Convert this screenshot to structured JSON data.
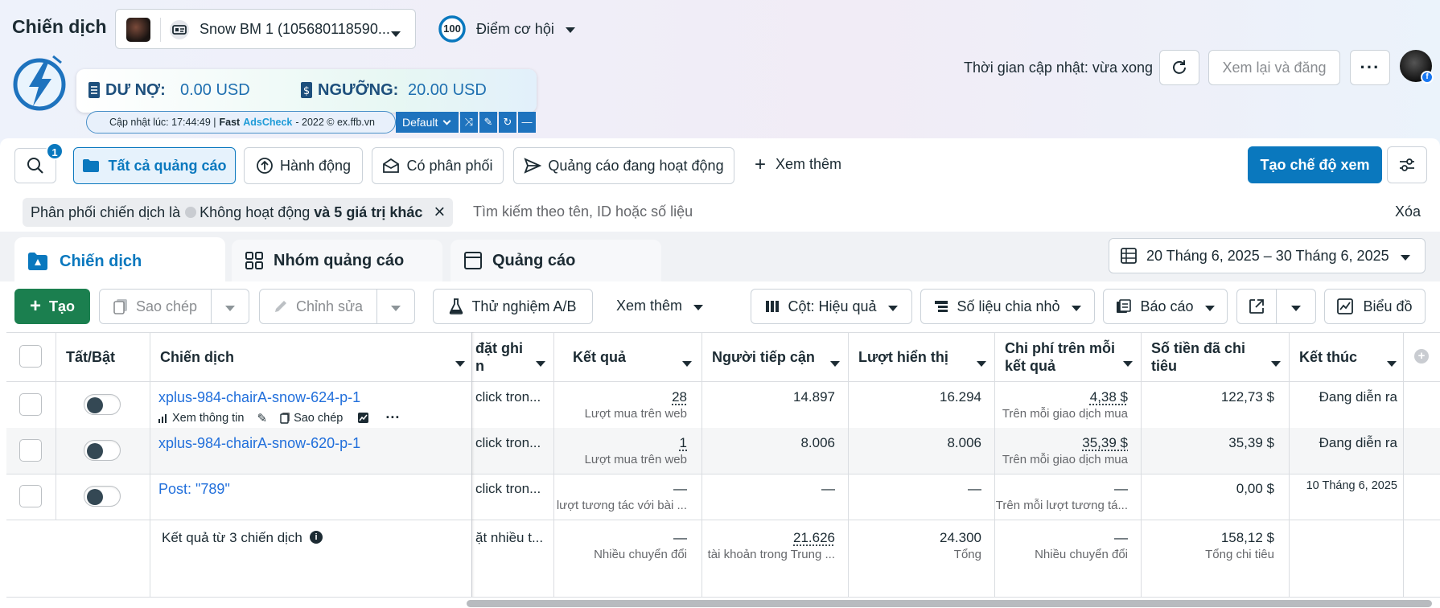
{
  "header": {
    "title": "Chiến dịch",
    "account_name": "Snow BM 1 (105680118590...",
    "opp_score_value": "100",
    "opp_score_label": "Điểm cơ hội",
    "update_time": "Thời gian cập nhật: vừa xong",
    "review_publish": "Xem lại và đăng"
  },
  "extension": {
    "debt_label": "DƯ NỢ:",
    "debt_value": "0.00 USD",
    "threshold_label": "NGƯỠNG:",
    "threshold_value": "20.00 USD",
    "updated_at": "Cập nhật lúc: 17:44:49 |",
    "brand_fast": "Fast",
    "brand_adscheck": "AdsCheck",
    "copyright": "- 2022 © ex.ffb.vn",
    "default_label": "Default"
  },
  "toolbar": {
    "search_badge": "1",
    "all_ads": "Tất cả quảng cáo",
    "actions": "Hành động",
    "delivered": "Có phân phối",
    "active_ads": "Quảng cáo đang hoạt động",
    "see_more": "Xem thêm",
    "create_view": "Tạo chế độ xem"
  },
  "filter": {
    "chip_prefix": "Phân phối chiến dịch là",
    "chip_value": "Không hoạt động",
    "chip_suffix": "và 5 giá trị khác",
    "search_placeholder": "Tìm kiếm theo tên, ID hoặc số liệu",
    "clear": "Xóa"
  },
  "tabs": {
    "campaigns": "Chiến dịch",
    "adsets": "Nhóm quảng cáo",
    "ads": "Quảng cáo",
    "date_range": "20 Tháng 6, 2025 – 30 Tháng 6, 2025"
  },
  "actions_bar": {
    "create": "Tạo",
    "duplicate": "Sao chép",
    "edit": "Chỉnh sửa",
    "ab_test": "Thử nghiệm A/B",
    "see_more": "Xem thêm",
    "columns": "Cột: Hiệu quả",
    "breakdown": "Số liệu chia nhỏ",
    "reports": "Báo cáo",
    "chart": "Biểu đồ"
  },
  "table": {
    "headers": {
      "toggle": "Tất/Bật",
      "campaign": "Chiến dịch",
      "bid_line1": "đặt ghi",
      "bid_line2": "n",
      "results": "Kết quả",
      "reach": "Người tiếp cận",
      "impressions": "Lượt hiển thị",
      "cost_line1": "Chi phí trên mỗi",
      "cost_line2": "kết quả",
      "spent_line1": "Số tiền đã chi",
      "spent_line2": "tiêu",
      "end": "Kết thúc"
    },
    "row_actions": {
      "view": "Xem thông tin",
      "duplicate": "Sao chép"
    },
    "rows": [
      {
        "name": "xplus-984-chairA-snow-624-p-1",
        "bid": "click tron...",
        "result": "28",
        "result_sub": "Lượt mua trên web",
        "reach": "14.897",
        "impressions": "16.294",
        "cost": "4,38 $",
        "cost_sub": "Trên mỗi giao dịch mua",
        "spent": "122,73 $",
        "end": "Đang diễn ra"
      },
      {
        "name": "xplus-984-chairA-snow-620-p-1",
        "bid": "click tron...",
        "result": "1",
        "result_sub": "Lượt mua trên web",
        "reach": "8.006",
        "impressions": "8.006",
        "cost": "35,39 $",
        "cost_sub": "Trên mỗi giao dịch mua",
        "spent": "35,39 $",
        "end": "Đang diễn ra"
      },
      {
        "name": "Post: \"789\"",
        "bid": "click tron...",
        "result": "—",
        "result_sub": "lượt tương tác với bài ...",
        "reach": "—",
        "impressions": "—",
        "cost": "—",
        "cost_sub": "Trên mỗi lượt tương tá...",
        "spent": "0,00 $",
        "end": "10 Tháng 6, 2025"
      }
    ],
    "summary": {
      "label": "Kết quả từ 3 chiến dịch",
      "bid": "ặt nhiều t...",
      "result": "—",
      "result_sub": "Nhiều chuyển đổi",
      "reach": "21.626",
      "reach_sub": "tài khoản trong Trung ...",
      "impressions": "24.300",
      "impressions_sub": "Tổng",
      "cost": "—",
      "cost_sub": "Nhiều chuyển đổi",
      "spent": "158,12 $",
      "spent_sub": "Tổng chi tiêu"
    }
  },
  "colors": {
    "primary": "#0a78be",
    "create_green": "#1b7f4f",
    "link": "#216fdb",
    "ext_blue": "#1e73be"
  }
}
